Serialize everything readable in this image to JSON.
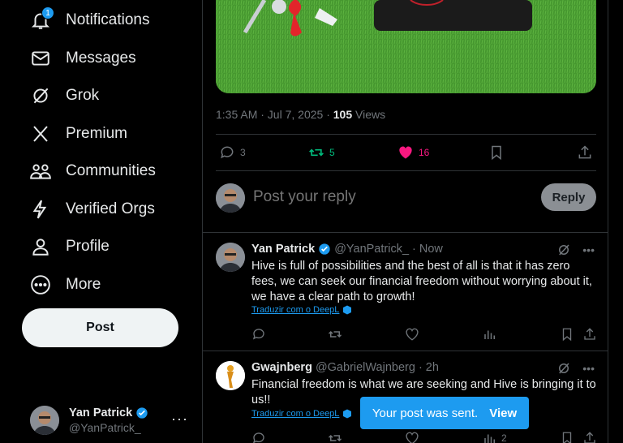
{
  "sidebar": {
    "items": [
      {
        "label": "Notifications",
        "icon": "bell-icon",
        "badge": "1"
      },
      {
        "label": "Messages",
        "icon": "envelope-icon"
      },
      {
        "label": "Grok",
        "icon": "grok-icon"
      },
      {
        "label": "Premium",
        "icon": "x-logo-icon"
      },
      {
        "label": "Communities",
        "icon": "people-icon"
      },
      {
        "label": "Verified Orgs",
        "icon": "lightning-icon"
      },
      {
        "label": "Profile",
        "icon": "person-icon"
      },
      {
        "label": "More",
        "icon": "more-circle-icon"
      }
    ],
    "post_label": "Post",
    "account": {
      "name": "Yan Patrick",
      "handle": "@YanPatrick_",
      "more": "···"
    }
  },
  "post": {
    "time": "1:35 AM · Jul 7, 2025 · ",
    "views_count": "105",
    "views_label": " Views",
    "stats": {
      "replies": "3",
      "reposts": "5",
      "likes": "16"
    },
    "colors": {
      "repost": "#00ba7c",
      "like": "#f91880",
      "accent": "#1d9bf0"
    }
  },
  "reply": {
    "placeholder": "Post your reply",
    "button": "Reply"
  },
  "replies": [
    {
      "name": "Yan Patrick",
      "handle": "@YanPatrick_ · Now",
      "text": "Hive is full of possibilities and the best of all is that it has zero fees, we can seek our financial freedom without worrying about it, we have a clear path to growth!",
      "translate": "Traduzir com o DeepL",
      "views": ""
    },
    {
      "name": "Gwajnberg",
      "handle": "@GabrielWajnberg · 2h",
      "text": "Financial freedom is what we are seeking and Hive is bringing it to us!!",
      "translate": "Traduzir com o DeepL",
      "views": "2"
    }
  ],
  "toast": {
    "message": "Your post was sent.",
    "action": "View"
  }
}
